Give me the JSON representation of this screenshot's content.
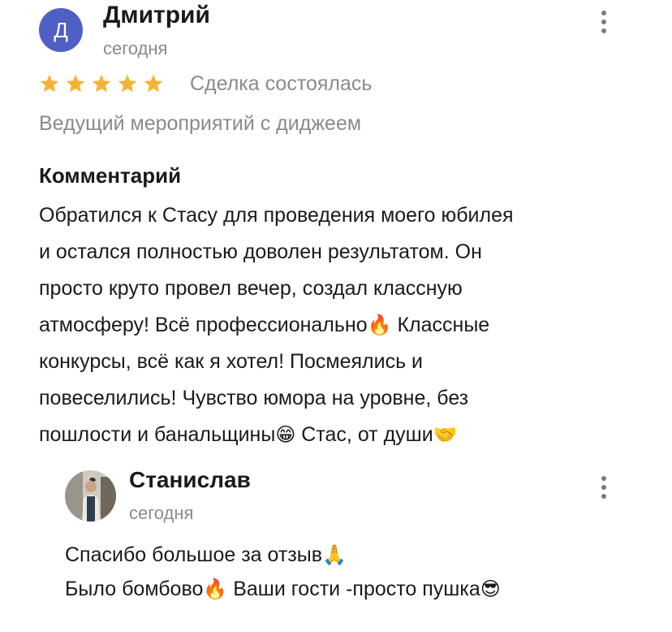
{
  "review": {
    "avatar_letter": "Д",
    "avatar_color": "#4f5fc4",
    "author": "Дмитрий",
    "date": "сегодня",
    "rating": 5,
    "rating_max": 5,
    "star_color": "#f5b335",
    "deal_status": "Сделка состоялась",
    "service": "Ведущий мероприятий с диджеем",
    "comment_heading": "Комментарий",
    "comment_lines": [
      {
        "text": "Обратился к Стасу для проведения моего юбилея"
      },
      {
        "text": "и остался полностью доволен результатом. Он"
      },
      {
        "text": "просто круто провел вечер, создал классную"
      },
      {
        "text": "атмосферу! Всё профессионально",
        "emoji": "🔥",
        "after": " Классные"
      },
      {
        "text": "конкурсы, всё как я хотел! Посмеялись и"
      },
      {
        "text": "повеселились! Чувство юмора на уровне, без"
      },
      {
        "text": "пошлости и банальщины",
        "emoji": "😁",
        "after": " Стас, от души",
        "emoji2": "🤝"
      }
    ]
  },
  "reply": {
    "author": "Станислав",
    "date": "сегодня",
    "avatar_icon": "user-photo",
    "lines": [
      {
        "text": "Спасибо большое за отзыв",
        "emoji": "🙏",
        "after": ""
      },
      {
        "text": "Было бомбово",
        "emoji": "🔥",
        "after": " Ваши гости -просто пушка",
        "emoji2": "😎"
      }
    ]
  },
  "icons": {
    "more": "kebab-menu-icon",
    "star": "star-icon"
  }
}
